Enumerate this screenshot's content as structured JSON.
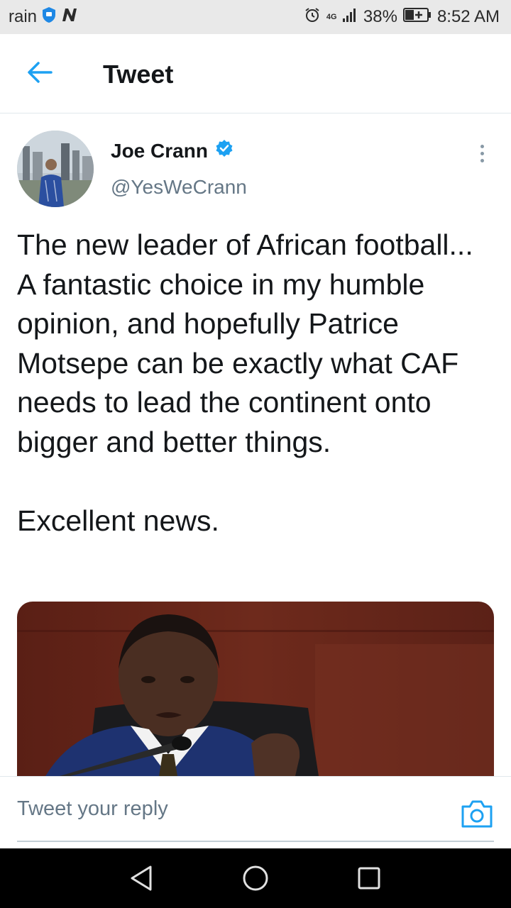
{
  "status_bar": {
    "carrier": "rain",
    "network": "4G",
    "battery": "38%",
    "time": "8:52 AM"
  },
  "header": {
    "title": "Tweet",
    "back_icon": "arrow-left-icon"
  },
  "tweet": {
    "author_name": "Joe Crann",
    "author_handle": "@YesWeCrann",
    "verified": true,
    "text": "The new leader of African football... A fantastic choice in my humble opinion, and hopefully Patrice Motsepe can be exactly what CAF needs to lead the continent onto bigger and better things.\n\nExcellent news.",
    "accent_color": "#1da1f2"
  },
  "reply": {
    "placeholder": "Tweet your reply",
    "camera_icon": "camera-icon"
  },
  "navigation": {
    "back_icon": "triangle-back-icon",
    "home_icon": "circle-home-icon",
    "recents_icon": "square-recents-icon"
  }
}
